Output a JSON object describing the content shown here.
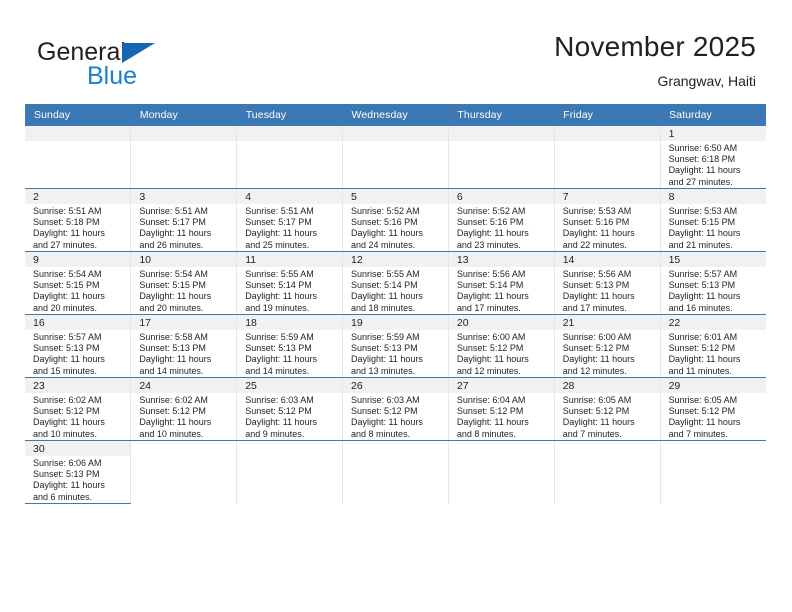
{
  "brand": {
    "name_top": "General",
    "name_bottom": "Blue",
    "triangle_color": "#1567b3",
    "blue_text_color": "#1a7fd4"
  },
  "header": {
    "month_title": "November 2025",
    "location": "Grangwav, Haiti"
  },
  "theme": {
    "header_band": "#3c78b4",
    "daynum_band": "#f1f1f1",
    "row_divider": "#3c78b4",
    "cell_divider": "#e7e7e7",
    "text": "#231f20"
  },
  "weekday_headers": [
    "Sunday",
    "Monday",
    "Tuesday",
    "Wednesday",
    "Thursday",
    "Friday",
    "Saturday"
  ],
  "labels": {
    "sunrise_prefix": "Sunrise: ",
    "sunset_prefix": "Sunset: ",
    "daylight_prefix": "Daylight: "
  },
  "weeks": [
    [
      {
        "empty": true
      },
      {
        "empty": true
      },
      {
        "empty": true
      },
      {
        "empty": true
      },
      {
        "empty": true
      },
      {
        "empty": true
      },
      {
        "day": "1",
        "sunrise": "Sunrise: 6:50 AM",
        "sunset": "Sunset: 6:18 PM",
        "daylight1": "Daylight: 11 hours",
        "daylight2": "and 27 minutes."
      }
    ],
    [
      {
        "day": "2",
        "sunrise": "Sunrise: 5:51 AM",
        "sunset": "Sunset: 5:18 PM",
        "daylight1": "Daylight: 11 hours",
        "daylight2": "and 27 minutes."
      },
      {
        "day": "3",
        "sunrise": "Sunrise: 5:51 AM",
        "sunset": "Sunset: 5:17 PM",
        "daylight1": "Daylight: 11 hours",
        "daylight2": "and 26 minutes."
      },
      {
        "day": "4",
        "sunrise": "Sunrise: 5:51 AM",
        "sunset": "Sunset: 5:17 PM",
        "daylight1": "Daylight: 11 hours",
        "daylight2": "and 25 minutes."
      },
      {
        "day": "5",
        "sunrise": "Sunrise: 5:52 AM",
        "sunset": "Sunset: 5:16 PM",
        "daylight1": "Daylight: 11 hours",
        "daylight2": "and 24 minutes."
      },
      {
        "day": "6",
        "sunrise": "Sunrise: 5:52 AM",
        "sunset": "Sunset: 5:16 PM",
        "daylight1": "Daylight: 11 hours",
        "daylight2": "and 23 minutes."
      },
      {
        "day": "7",
        "sunrise": "Sunrise: 5:53 AM",
        "sunset": "Sunset: 5:16 PM",
        "daylight1": "Daylight: 11 hours",
        "daylight2": "and 22 minutes."
      },
      {
        "day": "8",
        "sunrise": "Sunrise: 5:53 AM",
        "sunset": "Sunset: 5:15 PM",
        "daylight1": "Daylight: 11 hours",
        "daylight2": "and 21 minutes."
      }
    ],
    [
      {
        "day": "9",
        "sunrise": "Sunrise: 5:54 AM",
        "sunset": "Sunset: 5:15 PM",
        "daylight1": "Daylight: 11 hours",
        "daylight2": "and 20 minutes."
      },
      {
        "day": "10",
        "sunrise": "Sunrise: 5:54 AM",
        "sunset": "Sunset: 5:15 PM",
        "daylight1": "Daylight: 11 hours",
        "daylight2": "and 20 minutes."
      },
      {
        "day": "11",
        "sunrise": "Sunrise: 5:55 AM",
        "sunset": "Sunset: 5:14 PM",
        "daylight1": "Daylight: 11 hours",
        "daylight2": "and 19 minutes."
      },
      {
        "day": "12",
        "sunrise": "Sunrise: 5:55 AM",
        "sunset": "Sunset: 5:14 PM",
        "daylight1": "Daylight: 11 hours",
        "daylight2": "and 18 minutes."
      },
      {
        "day": "13",
        "sunrise": "Sunrise: 5:56 AM",
        "sunset": "Sunset: 5:14 PM",
        "daylight1": "Daylight: 11 hours",
        "daylight2": "and 17 minutes."
      },
      {
        "day": "14",
        "sunrise": "Sunrise: 5:56 AM",
        "sunset": "Sunset: 5:13 PM",
        "daylight1": "Daylight: 11 hours",
        "daylight2": "and 17 minutes."
      },
      {
        "day": "15",
        "sunrise": "Sunrise: 5:57 AM",
        "sunset": "Sunset: 5:13 PM",
        "daylight1": "Daylight: 11 hours",
        "daylight2": "and 16 minutes."
      }
    ],
    [
      {
        "day": "16",
        "sunrise": "Sunrise: 5:57 AM",
        "sunset": "Sunset: 5:13 PM",
        "daylight1": "Daylight: 11 hours",
        "daylight2": "and 15 minutes."
      },
      {
        "day": "17",
        "sunrise": "Sunrise: 5:58 AM",
        "sunset": "Sunset: 5:13 PM",
        "daylight1": "Daylight: 11 hours",
        "daylight2": "and 14 minutes."
      },
      {
        "day": "18",
        "sunrise": "Sunrise: 5:59 AM",
        "sunset": "Sunset: 5:13 PM",
        "daylight1": "Daylight: 11 hours",
        "daylight2": "and 14 minutes."
      },
      {
        "day": "19",
        "sunrise": "Sunrise: 5:59 AM",
        "sunset": "Sunset: 5:13 PM",
        "daylight1": "Daylight: 11 hours",
        "daylight2": "and 13 minutes."
      },
      {
        "day": "20",
        "sunrise": "Sunrise: 6:00 AM",
        "sunset": "Sunset: 5:12 PM",
        "daylight1": "Daylight: 11 hours",
        "daylight2": "and 12 minutes."
      },
      {
        "day": "21",
        "sunrise": "Sunrise: 6:00 AM",
        "sunset": "Sunset: 5:12 PM",
        "daylight1": "Daylight: 11 hours",
        "daylight2": "and 12 minutes."
      },
      {
        "day": "22",
        "sunrise": "Sunrise: 6:01 AM",
        "sunset": "Sunset: 5:12 PM",
        "daylight1": "Daylight: 11 hours",
        "daylight2": "and 11 minutes."
      }
    ],
    [
      {
        "day": "23",
        "sunrise": "Sunrise: 6:02 AM",
        "sunset": "Sunset: 5:12 PM",
        "daylight1": "Daylight: 11 hours",
        "daylight2": "and 10 minutes."
      },
      {
        "day": "24",
        "sunrise": "Sunrise: 6:02 AM",
        "sunset": "Sunset: 5:12 PM",
        "daylight1": "Daylight: 11 hours",
        "daylight2": "and 10 minutes."
      },
      {
        "day": "25",
        "sunrise": "Sunrise: 6:03 AM",
        "sunset": "Sunset: 5:12 PM",
        "daylight1": "Daylight: 11 hours",
        "daylight2": "and 9 minutes."
      },
      {
        "day": "26",
        "sunrise": "Sunrise: 6:03 AM",
        "sunset": "Sunset: 5:12 PM",
        "daylight1": "Daylight: 11 hours",
        "daylight2": "and 8 minutes."
      },
      {
        "day": "27",
        "sunrise": "Sunrise: 6:04 AM",
        "sunset": "Sunset: 5:12 PM",
        "daylight1": "Daylight: 11 hours",
        "daylight2": "and 8 minutes."
      },
      {
        "day": "28",
        "sunrise": "Sunrise: 6:05 AM",
        "sunset": "Sunset: 5:12 PM",
        "daylight1": "Daylight: 11 hours",
        "daylight2": "and 7 minutes."
      },
      {
        "day": "29",
        "sunrise": "Sunrise: 6:05 AM",
        "sunset": "Sunset: 5:12 PM",
        "daylight1": "Daylight: 11 hours",
        "daylight2": "and 7 minutes."
      }
    ],
    [
      {
        "day": "30",
        "sunrise": "Sunrise: 6:06 AM",
        "sunset": "Sunset: 5:13 PM",
        "daylight1": "Daylight: 11 hours",
        "daylight2": "and 6 minutes."
      },
      {
        "blank": true
      },
      {
        "blank": true
      },
      {
        "blank": true
      },
      {
        "blank": true
      },
      {
        "blank": true
      },
      {
        "blank": true
      }
    ]
  ]
}
